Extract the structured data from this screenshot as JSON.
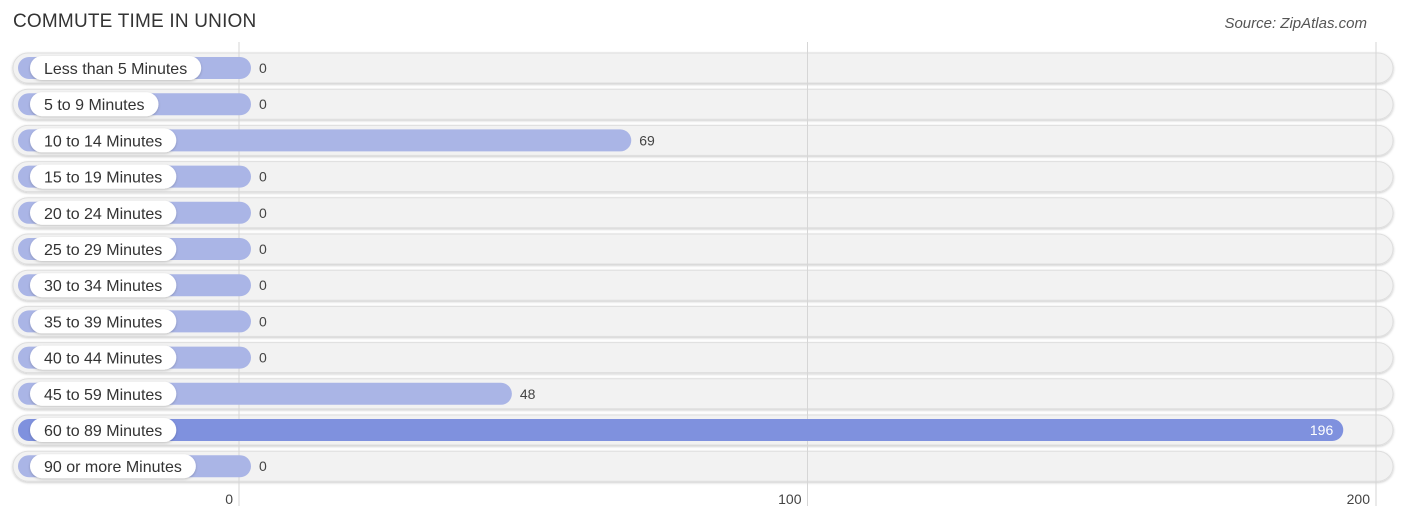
{
  "header": {
    "title": "COMMUTE TIME IN UNION",
    "source": "Source: ZipAtlas.com"
  },
  "colors": {
    "bar_normal": "#aab5e6",
    "bar_highlight": "#7f91de",
    "track": "#f2f2f2"
  },
  "chart_data": {
    "type": "bar",
    "orientation": "horizontal",
    "title": "COMMUTE TIME IN UNION",
    "xlabel": "",
    "ylabel": "",
    "xlim": [
      0,
      200
    ],
    "xticks": [
      0,
      100,
      200
    ],
    "xtick_labels": [
      "0",
      "100",
      "200"
    ],
    "grid": true,
    "categories": [
      "Less than 5 Minutes",
      "5 to 9 Minutes",
      "10 to 14 Minutes",
      "15 to 19 Minutes",
      "20 to 24 Minutes",
      "25 to 29 Minutes",
      "30 to 34 Minutes",
      "35 to 39 Minutes",
      "40 to 44 Minutes",
      "45 to 59 Minutes",
      "60 to 89 Minutes",
      "90 or more Minutes"
    ],
    "values": [
      0,
      0,
      69,
      0,
      0,
      0,
      0,
      0,
      0,
      48,
      196,
      0
    ],
    "value_labels": [
      "0",
      "0",
      "69",
      "0",
      "0",
      "0",
      "0",
      "0",
      "0",
      "48",
      "196",
      "0"
    ],
    "highlight_index": 10
  }
}
